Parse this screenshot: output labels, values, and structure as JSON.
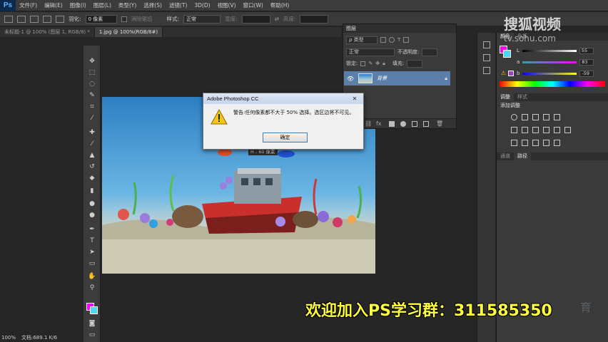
{
  "app": {
    "logo": "Ps",
    "menu": [
      "文件(F)",
      "编辑(E)",
      "图像(I)",
      "图层(L)",
      "类型(Y)",
      "选择(S)",
      "滤镜(T)",
      "3D(D)",
      "视图(V)",
      "窗口(W)",
      "帮助(H)"
    ]
  },
  "options_bar": {
    "feather_label": "羽化:",
    "feather_value": "0 像素",
    "antialias_label": "消除锯齿",
    "style_label": "样式:",
    "style_value": "正常",
    "width_label": "宽度:",
    "height_label": "高度:"
  },
  "tabs": [
    {
      "label": "未标题-1 @ 100% (图层 1, RGB/8) *",
      "active": false
    },
    {
      "label": "1.jpg @ 100%(RGB/8#)",
      "active": true
    }
  ],
  "tools": [
    "move",
    "marquee",
    "lasso",
    "quick-select",
    "crop",
    "eyedropper",
    "healing",
    "brush",
    "stamp",
    "history-brush",
    "eraser",
    "gradient",
    "blur",
    "dodge",
    "pen",
    "type",
    "path-select",
    "shape",
    "hand",
    "zoom"
  ],
  "status": {
    "zoom": "100%",
    "doc_size": "文档:689.1 K/6"
  },
  "layers_panel": {
    "title": "图层",
    "filter_label": "ρ 类型",
    "blend_mode": "正常",
    "opacity_label": "不透明度:",
    "lock_label": "锁定:",
    "fill_label": "填充:",
    "layer_name": "背景"
  },
  "color_panel": {
    "tabs": [
      "颜色",
      "色板"
    ],
    "sliders": [
      {
        "label": "L",
        "value": "55"
      },
      {
        "label": "a",
        "value": "83"
      },
      {
        "label": "b",
        "value": "-59"
      }
    ]
  },
  "adjust_panel": {
    "tabs": [
      "调整",
      "样式"
    ],
    "title": "添加调整"
  },
  "paths_panel": {
    "tabs": [
      "通道",
      "路径"
    ]
  },
  "dialog": {
    "title": "Adobe Photoshop CC",
    "close": "✕",
    "message": "警告:任何像素都不大于 50% 选择。选区边将不可见。",
    "ok": "确定"
  },
  "canvas_tooltip": "H : 60 像素",
  "banner": "欢迎加入PS学习群：311585350",
  "watermark": {
    "main": "搜狐视频",
    "sub": "tv.sohu.com",
    "corner": "育"
  },
  "colors": {
    "foreground": "#ff00ff",
    "background": "#4cd7f0",
    "banner": "#ffff3c"
  }
}
